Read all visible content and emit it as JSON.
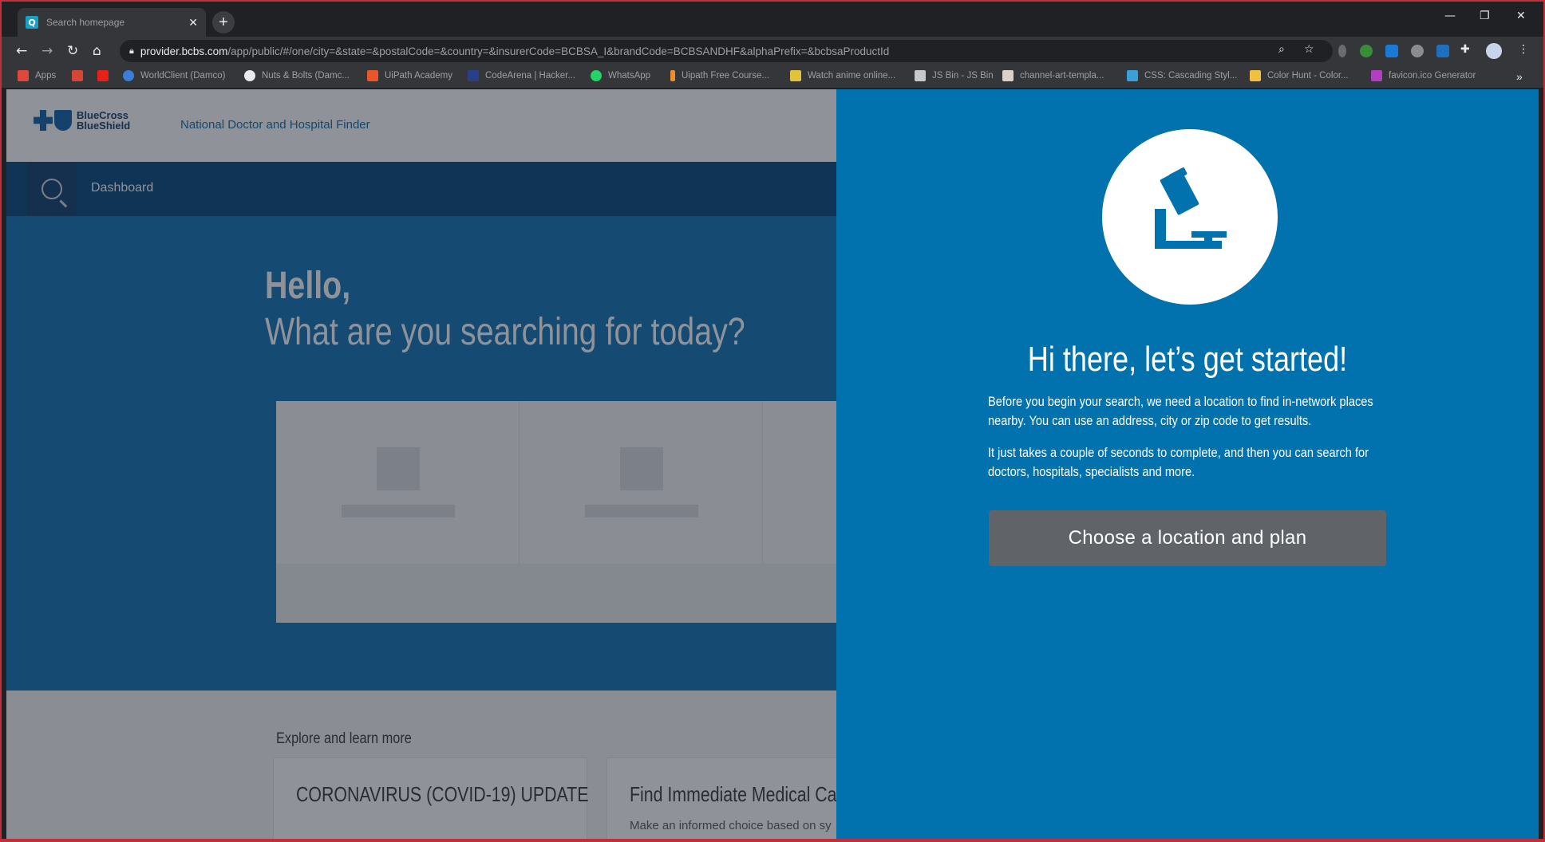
{
  "browser": {
    "tab_title": "Search homepage",
    "tab_favicon": "Q",
    "url_host": "provider.bcbs.com",
    "url_path": "/app/public/#/one/city=&state=&postalCode=&country=&insurerCode=BCBSA_I&brandCode=BCBSANDHF&alphaPrefix=&bcbsaProductId",
    "bookmarks": [
      "Apps",
      "",
      "",
      "WorldClient (Damco)",
      "Nuts & Bolts (Damc...",
      "UiPath Academy",
      "CodeArena | Hacker...",
      "WhatsApp",
      "Uipath Free Course...",
      "Watch anime online...",
      "JS Bin - JS Bin",
      "channel-art-templa...",
      "CSS: Cascading Styl...",
      "Color Hunt - Color...",
      "favicon.ico Generator"
    ]
  },
  "site": {
    "brand_line1": "BlueCross",
    "brand_line2": "BlueShield",
    "finder_title": "National Doctor and Hospital Finder",
    "nav_dashboard": "Dashboard"
  },
  "hero": {
    "hello": "Hello,",
    "question": "What are you searching for today?"
  },
  "explore": {
    "heading": "Explore and learn more",
    "cards": [
      {
        "title": "CORONAVIRUS (COVID-19) UPDATE",
        "subtitle": ""
      },
      {
        "title": "Find Immediate Medical Ca",
        "subtitle": "Make an informed choice based on sy"
      }
    ]
  },
  "panel": {
    "title": "Hi there, let’s get started!",
    "para1": "Before you begin your search, we need a location to find in-network places nearby. You can use an address, city or zip code to get results.",
    "para2": "It just takes a couple of seconds to complete, and then you can search for doctors, hospitals, specialists and more.",
    "cta": "Choose a location and plan",
    "icon": "microscope-icon"
  },
  "colors": {
    "panel_bg": "#0172ae",
    "cta_bg": "#606469",
    "brand": "#0a5ea8"
  }
}
